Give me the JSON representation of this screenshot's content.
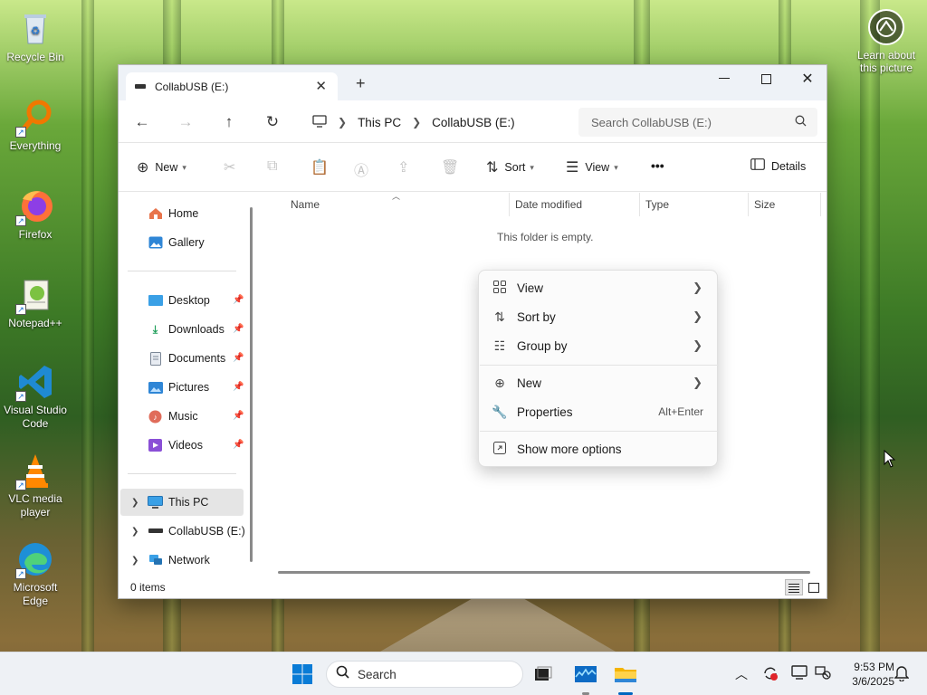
{
  "desktop": {
    "icons": [
      {
        "label": "Recycle Bin"
      },
      {
        "label": "Everything"
      },
      {
        "label": "Firefox"
      },
      {
        "label": "Notepad++"
      },
      {
        "label": "Visual Studio Code"
      },
      {
        "label": "VLC media player"
      },
      {
        "label": "Microsoft Edge"
      }
    ],
    "learn_label": "Learn about this picture"
  },
  "window": {
    "tab_title": "CollabUSB (E:)",
    "breadcrumb": [
      "This PC",
      "CollabUSB (E:)"
    ],
    "search_placeholder": "Search CollabUSB (E:)",
    "toolbar": {
      "new_label": "New",
      "sort_label": "Sort",
      "view_label": "View",
      "more_label": "•••",
      "details_label": "Details"
    },
    "sidebar": {
      "home": "Home",
      "gallery": "Gallery",
      "pinned": [
        "Desktop",
        "Downloads",
        "Documents",
        "Pictures",
        "Music",
        "Videos"
      ],
      "this_pc": "This PC",
      "usb": "CollabUSB (E:)",
      "network": "Network"
    },
    "columns": [
      "Name",
      "Date modified",
      "Type",
      "Size"
    ],
    "empty_message": "This folder is empty.",
    "status": "0 items"
  },
  "context_menu": {
    "items": [
      {
        "label": "View"
      },
      {
        "label": "Sort by"
      },
      {
        "label": "Group by"
      },
      {
        "label": "New"
      },
      {
        "label": "Properties",
        "shortcut": "Alt+Enter"
      },
      {
        "label": "Show more options"
      }
    ]
  },
  "taskbar": {
    "search_label": "Search",
    "time": "9:53 PM",
    "date": "3/6/2025"
  },
  "colors": {
    "accent": "#0067c0",
    "window_bg": "#ffffff",
    "titlebar_bg": "#eef2f7",
    "taskbar_bg": "#eef1f5"
  }
}
